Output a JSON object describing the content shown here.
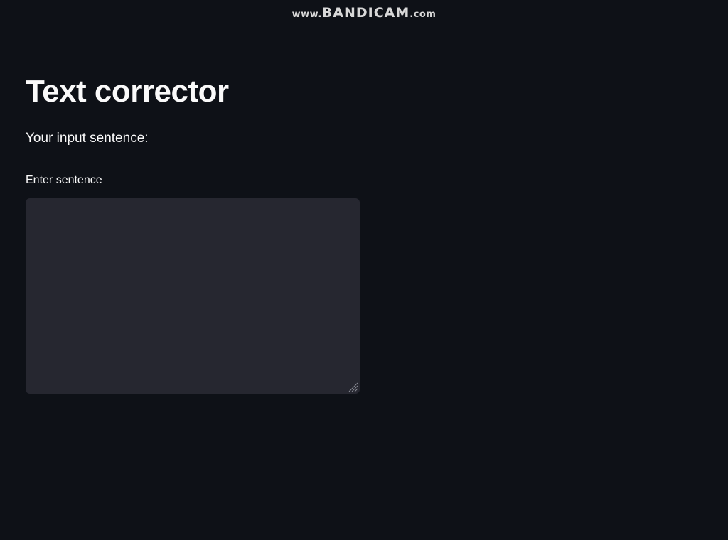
{
  "watermark": {
    "prefix": "www.",
    "brand": "BANDICAM",
    "suffix": ".com"
  },
  "page": {
    "title": "Text corrector",
    "subtitle": "Your input sentence:"
  },
  "input": {
    "label": "Enter sentence",
    "value": "",
    "placeholder": ""
  },
  "theme": {
    "background": "#0e1117",
    "input_background": "#262730",
    "text": "#fafafa"
  },
  "icons": {
    "resize_grip": "resize-grip-icon"
  }
}
